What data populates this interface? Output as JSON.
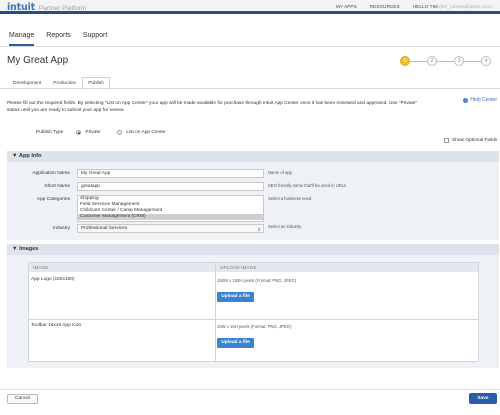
{
  "header": {
    "logo": "intuit",
    "product": "Partner Platform",
    "nav": [
      "MY APPS",
      "RESOURCES"
    ],
    "greeting": "HELLO TIM",
    "email": "(tim_roberts@intuit.com)"
  },
  "main_tabs": [
    "Manage",
    "Reports",
    "Support"
  ],
  "page_title": "My Great App",
  "steps": [
    "1",
    "2",
    "3",
    "4"
  ],
  "sub_tabs": [
    "Development",
    "Production",
    "Publish"
  ],
  "help_link": "Help Center",
  "intro_text": "Please fill out the required fields. By selecting \"List on App Center\" your app will be made available for purchase through Intuit App Center once it has been reviewed and approved. Use \"Private\" status until you are ready to submit your app for review.",
  "publish_type": {
    "label": "Publish Type",
    "options": [
      "Private",
      "List on App Center"
    ],
    "selected": "Private"
  },
  "optional_fields_label": "Show Optional Fields",
  "app_info": {
    "title": "App Info",
    "application_name": {
      "label": "Application Name",
      "value": "My Great App",
      "hint": "Name of app"
    },
    "short_name": {
      "label": "Short Name",
      "value": "greatapp",
      "hint": "SEO friendly name that'll be used in URLs"
    },
    "categories": {
      "label": "App Categories",
      "options": [
        "Shipping",
        "Field Services Management",
        "Childcare Center / Camp Management",
        "Customer Management (CRM)"
      ],
      "selected": "Customer Management (CRM)",
      "hint": "Select a business need"
    },
    "industry": {
      "label": "Industry",
      "value": "Professional Services",
      "hint": "Select an industry"
    }
  },
  "images": {
    "title": "Images",
    "col_image": "IMAGE",
    "col_upload": "UPLOAD IMAGE",
    "rows": [
      {
        "label": "App Logo (150x150)",
        "spec": "150W x 150H pixels (Format: PNG, JPEG)",
        "button": "Upload a file"
      },
      {
        "label": "Toolbar 16x16 App Icon",
        "spec": "16W x 16H pixels (Format: PNG, JPEG)",
        "button": "Upload a file"
      }
    ]
  },
  "footer": {
    "cancel": "Cancel",
    "save": "Save"
  },
  "colors": {
    "accent": "#2e5aa0",
    "step_active": "#f2c12e",
    "upload_button": "#3a83d1"
  }
}
